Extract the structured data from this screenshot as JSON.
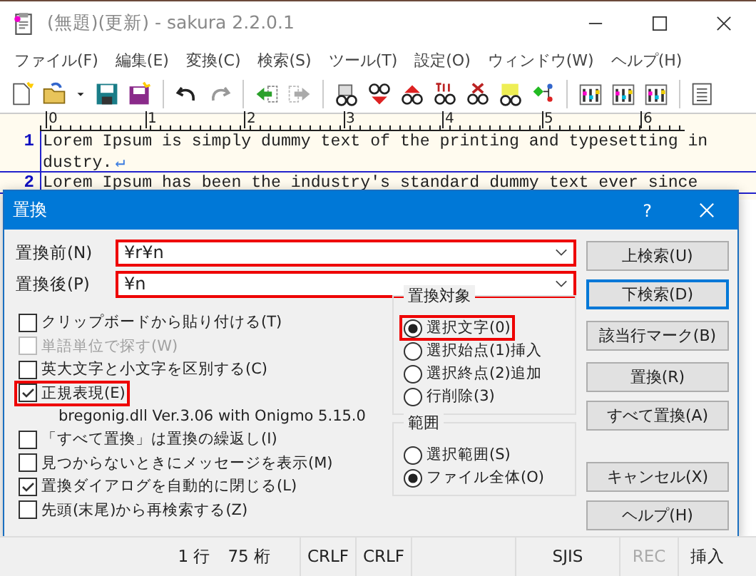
{
  "window": {
    "title": "(無題)(更新) - sakura 2.2.0.1"
  },
  "menu": [
    "ファイル(F)",
    "編集(E)",
    "変換(C)",
    "検索(S)",
    "ツール(T)",
    "設定(O)",
    "ウィンドウ(W)",
    "ヘルプ(H)"
  ],
  "ruler": [
    "0",
    "1",
    "2",
    "3",
    "4",
    "5",
    "6"
  ],
  "lines": [
    {
      "number": "1",
      "rows": [
        "Lorem Ipsum is simply dummy text of the printing and typesetting in",
        "dustry."
      ],
      "eol": "↵"
    },
    {
      "number": "2",
      "rows": [
        "Lorem Ipsum has been the industry's standard dummy text ever since"
      ]
    }
  ],
  "dialog": {
    "title": "置換",
    "help": "?",
    "fields": [
      {
        "label": "置換前(N)",
        "value": "¥r¥n",
        "highlighted": true
      },
      {
        "label": "置換後(P)",
        "value": "¥n",
        "highlighted": true
      }
    ],
    "options": [
      {
        "kind": "checkbox",
        "label": "クリップボードから貼り付ける(T)",
        "checked": false,
        "disabled": false,
        "highlighted": false
      },
      {
        "kind": "checkbox",
        "label": "単語単位で探す(W)",
        "checked": false,
        "disabled": true,
        "highlighted": false
      },
      {
        "kind": "checkbox",
        "label": "英大文字と小文字を区別する(C)",
        "checked": false,
        "disabled": false,
        "highlighted": false
      },
      {
        "kind": "checkbox",
        "label": "正規表現(E)",
        "checked": true,
        "disabled": false,
        "highlighted": true
      },
      {
        "kind": "note",
        "label": "bregonig.dll Ver.3.06 with Onigmo 5.15.0"
      },
      {
        "kind": "checkbox",
        "label": "「すべて置換」は置換の繰返し(I)",
        "checked": false,
        "disabled": false,
        "highlighted": false
      },
      {
        "kind": "checkbox",
        "label": "見つからないときにメッセージを表示(M)",
        "checked": false,
        "disabled": false,
        "highlighted": false
      },
      {
        "kind": "checkbox",
        "label": "置換ダイアログを自動的に閉じる(L)",
        "checked": true,
        "disabled": false,
        "highlighted": false
      },
      {
        "kind": "checkbox",
        "label": "先頭(末尾)から再検索する(Z)",
        "checked": false,
        "disabled": false,
        "highlighted": false
      }
    ],
    "groups": [
      {
        "title": "置換対象",
        "options": [
          {
            "label": "選択文字(0)",
            "selected": true,
            "highlighted": true
          },
          {
            "label": "選択始点(1)挿入",
            "selected": false,
            "highlighted": false
          },
          {
            "label": "選択終点(2)追加",
            "selected": false,
            "highlighted": false
          },
          {
            "label": "行削除(3)",
            "selected": false,
            "highlighted": false
          }
        ]
      },
      {
        "title": "範囲",
        "options": [
          {
            "label": "選択範囲(S)",
            "selected": false,
            "highlighted": false
          },
          {
            "label": "ファイル全体(O)",
            "selected": true,
            "highlighted": false
          }
        ]
      }
    ],
    "button_groups": [
      [
        {
          "label": "上検索(U)",
          "default": false
        },
        {
          "label": "下検索(D)",
          "default": true
        }
      ],
      [
        {
          "label": "該当行マーク(B)",
          "default": false
        }
      ],
      [
        {
          "label": "置換(R)",
          "default": false
        },
        {
          "label": "すべて置換(A)",
          "default": false
        }
      ],
      [
        {
          "label": "キャンセル(X)",
          "default": false
        },
        {
          "label": "ヘルプ(H)",
          "default": false
        }
      ]
    ]
  },
  "status_bar": [
    {
      "text": "1 行　75 桁",
      "disabled": false
    },
    {
      "text": "CRLF",
      "disabled": false
    },
    {
      "text": "CRLF",
      "disabled": false
    },
    {
      "text": "SJIS",
      "disabled": false
    },
    {
      "text": "REC",
      "disabled": true
    },
    {
      "text": "挿入",
      "disabled": false
    }
  ]
}
